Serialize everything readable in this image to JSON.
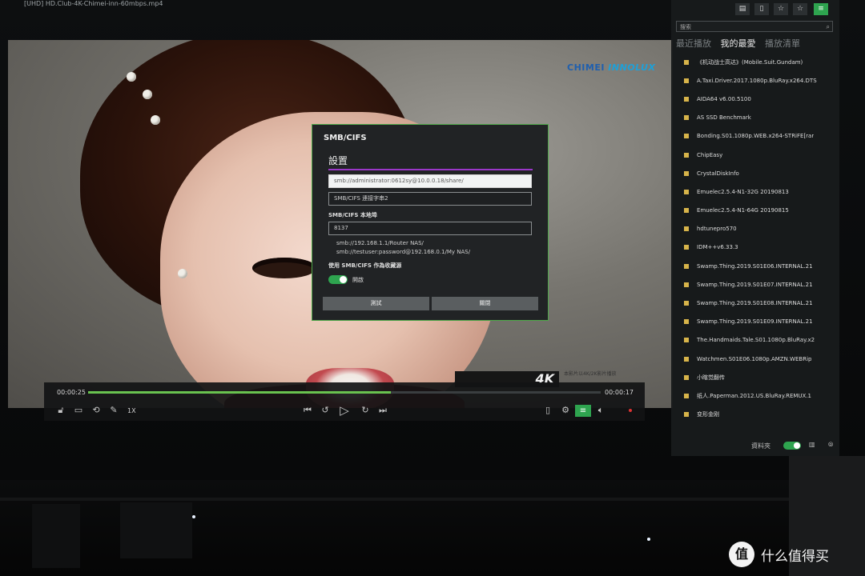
{
  "window": {
    "file_title": "[UHD] HD.Club-4K-Chimei-inn-60mbps.mp4"
  },
  "video": {
    "watermark_part1": "CHIMEI ",
    "watermark_part2": "INNOLUX",
    "badge": "4K",
    "badge_caption": "本影片以4K/2K影片播放"
  },
  "player": {
    "time_elapsed": "00:00:25",
    "time_remaining": "00:00:17",
    "progress": 0.59,
    "speed": "1X",
    "icons_left": [
      "lock-icon",
      "subtitle-icon",
      "loop-icon",
      "pen-icon"
    ],
    "icons_center": [
      "prev-icon",
      "rewind-10-icon",
      "play-icon",
      "forward-30-icon",
      "next-icon"
    ],
    "icons_right": [
      "file-icon",
      "settings-icon",
      "playlist-icon",
      "volume-icon"
    ]
  },
  "playlist_panel": {
    "search_placeholder": "搜索",
    "tabs": [
      {
        "label": "最近播放",
        "active": false
      },
      {
        "label": "我的最愛",
        "active": true
      },
      {
        "label": "播放清單",
        "active": false
      }
    ],
    "items": [
      "《机动战士高达》(Mobile.Suit.Gundam)",
      "A.Taxi.Driver.2017.1080p.BluRay.x264.DTS",
      "AIDA64 v6.00.5100",
      "AS SSD Benchmark",
      "Bonding.S01.1080p.WEB.x264-STRiFE[rar",
      "ChipEasy",
      "CrystalDiskInfo",
      "Emuelec2.5.4-N1-32G 20190813",
      "Emuelec2.5.4-N1-64G 20190815",
      "hdtunepro570",
      "IDM++v6.33.3",
      "Swamp.Thing.2019.S01E06.INTERNAL.21",
      "Swamp.Thing.2019.S01E07.INTERNAL.21",
      "Swamp.Thing.2019.S01E08.INTERNAL.21",
      "Swamp.Thing.2019.S01E09.INTERNAL.21",
      "The.Handmaids.Tale.S01.1080p.BluRay.x2",
      "Watchmen.S01E06.1080p.AMZN.WEBRip",
      "小瞎觉翻传",
      "纸人.Paperman.2012.US.BluRay.REMUX.1",
      "变形金刚"
    ],
    "bottom_label": "資料夾",
    "bottom_toggle_on": true
  },
  "dialog": {
    "title": "SMB/CIFS",
    "section": "設置",
    "url_value": "smb://administrator:0612sy@10.0.0.18/share/",
    "name_value": "SMB/CIFS 連接字串2",
    "local_label": "SMB/CIFS 本地埠",
    "port_value": "8137",
    "example1": "smb://192.168.1.1/Router NAS/",
    "example2": "smb://testuser:password@192.168.0.1/My NAS/",
    "favorite_label": "使用 SMB/CIFS 作為收藏源",
    "toggle_label": "開啟",
    "toggle_on": true,
    "test_button": "測試",
    "close_button": "關閉"
  },
  "footer": {
    "logo_text": "值",
    "brand_text": "什么值得买"
  },
  "colors": {
    "accent_green": "#2ea44f",
    "progress_green": "#69c24f",
    "dialog_border": "#4fa84a",
    "dialog_underline": "#9b37c9",
    "folder_yellow": "#d7b44a"
  }
}
